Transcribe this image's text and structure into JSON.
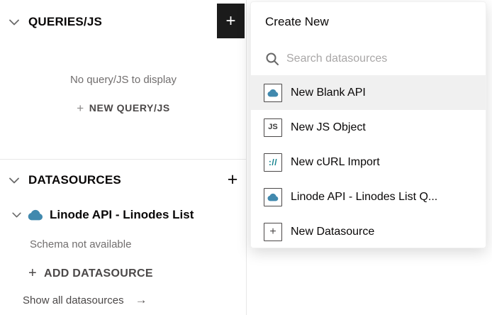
{
  "sidebar": {
    "queries_section": {
      "title": "QUERIES/JS",
      "empty_message": "No query/JS to display",
      "new_button_label": "NEW QUERY/JS",
      "new_button_plus": "+",
      "add_button_glyph": "+"
    },
    "datasources_section": {
      "title": "DATASOURCES",
      "add_button_glyph": "+",
      "datasource": {
        "name": "Linode API - Linodes List",
        "schema_status": "Schema not available"
      },
      "add_datasource_label": "ADD DATASOURCE",
      "add_datasource_plus": "+",
      "show_all_label": "Show all datasources",
      "show_all_arrow": "→"
    }
  },
  "dropdown": {
    "title": "Create New",
    "search_placeholder": "Search datasources",
    "items": [
      {
        "label": "New Blank API",
        "icon": "cloud-icon",
        "active": true
      },
      {
        "label": "New JS Object",
        "icon": "js-icon",
        "active": false
      },
      {
        "label": "New cURL Import",
        "icon": "curl-icon",
        "active": false
      },
      {
        "label": "Linode API - Linodes List Q...",
        "icon": "cloud-icon",
        "active": false
      },
      {
        "label": "New Datasource",
        "icon": "plus-icon",
        "active": false
      }
    ]
  },
  "icon_glyphs": {
    "js-icon": "JS",
    "curl-icon": "://",
    "plus-icon": "+"
  },
  "colors": {
    "cloud_blue": "#4189ae",
    "active_row_bg": "#f0f0f0",
    "dark_button_bg": "#1b1b1b",
    "text_dark": "#090707",
    "text_gray": "#716e6e",
    "placeholder_gray": "#a9a7a7",
    "border_gray": "#e7e7e7"
  }
}
